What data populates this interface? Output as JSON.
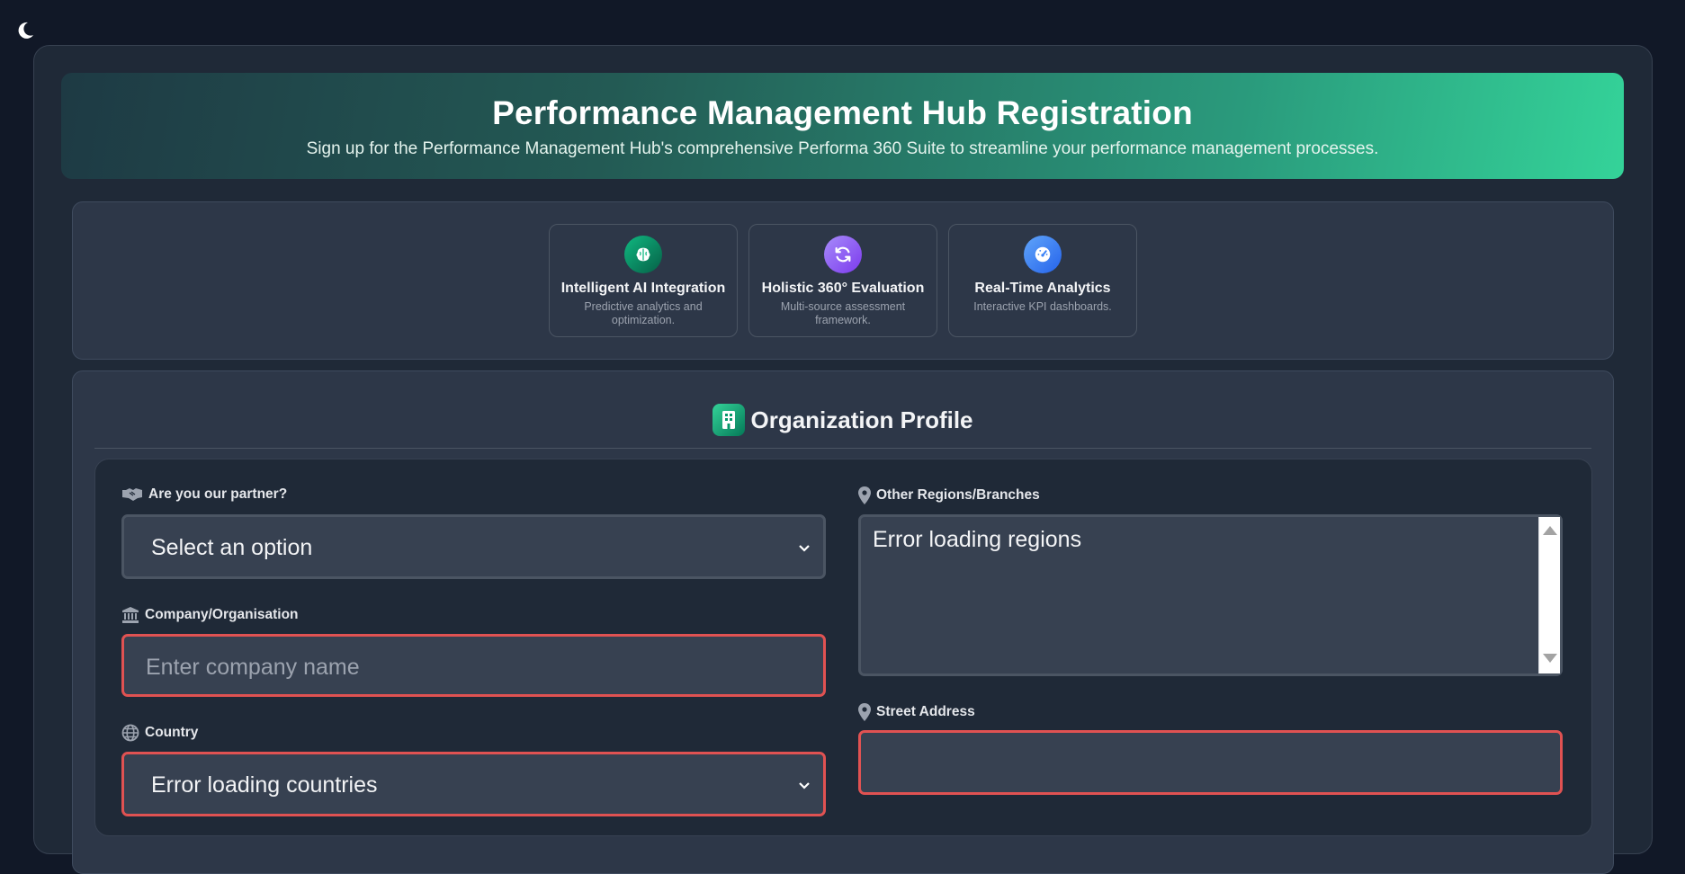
{
  "theme_toggle": {
    "icon": "moon-icon"
  },
  "hero": {
    "title": "Performance Management Hub Registration",
    "subtitle": "Sign up for the Performance Management Hub's comprehensive Performa 360 Suite to streamline your performance management processes."
  },
  "features": [
    {
      "icon": "brain-icon",
      "color": "#10b981",
      "title": "Intelligent AI Integration",
      "desc": "Predictive analytics and optimization."
    },
    {
      "icon": "refresh-icon",
      "color": "#8b5cf6",
      "title": "Holistic 360° Evaluation",
      "desc": "Multi-source assessment framework."
    },
    {
      "icon": "gauge-icon",
      "color": "#3b82f6",
      "title": "Real-Time Analytics",
      "desc": "Interactive KPI dashboards."
    }
  ],
  "org": {
    "title": "Organization Profile",
    "icon": "building-icon"
  },
  "form": {
    "partner": {
      "label": "Are you our partner?",
      "icon": "handshake-icon",
      "value": "Select an option"
    },
    "company": {
      "label": "Company/Organisation",
      "icon": "bank-icon",
      "placeholder": "Enter company name"
    },
    "country": {
      "label": "Country",
      "icon": "globe-icon",
      "value": "Error loading countries"
    },
    "regions": {
      "label": "Other Regions/Branches",
      "icon": "map-pin-icon",
      "value": "Error loading regions"
    },
    "street": {
      "label": "Street Address",
      "icon": "map-pin-icon",
      "value": ""
    }
  },
  "colors": {
    "accent": "#34d399",
    "error_border": "#e05252"
  }
}
